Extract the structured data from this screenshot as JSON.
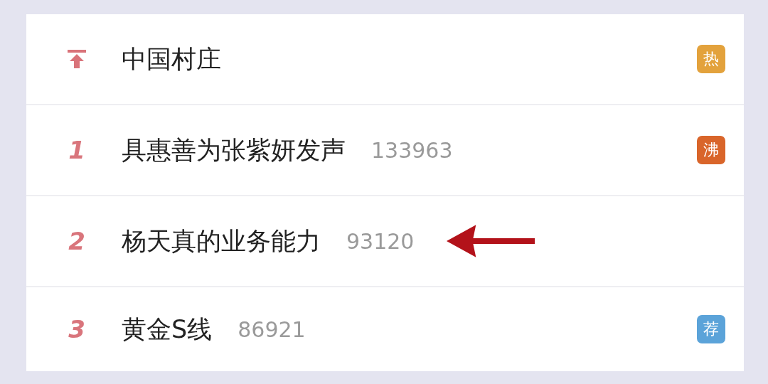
{
  "items": [
    {
      "kind": "pinned",
      "title": "中国村庄",
      "badge": {
        "label": "热",
        "color": "#e3a23c"
      },
      "marked": false
    },
    {
      "kind": "ranked",
      "rank": "1",
      "title": "具惠善为张紫妍发声",
      "count": "133963",
      "badge": {
        "label": "沸",
        "color": "#d9652a"
      },
      "marked": false
    },
    {
      "kind": "ranked",
      "rank": "2",
      "title": "杨天真的业务能力",
      "count": "93120",
      "marked": true
    },
    {
      "kind": "ranked",
      "rank": "3",
      "title": "黄金S线",
      "count": "86921",
      "badge": {
        "label": "荐",
        "color": "#5ba3d9"
      },
      "marked": false
    }
  ]
}
